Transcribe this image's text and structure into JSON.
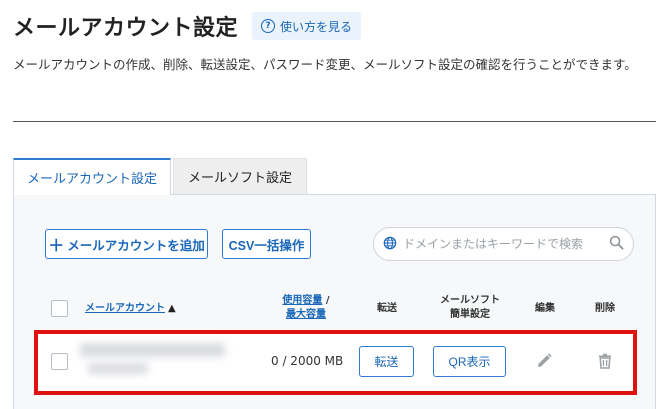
{
  "header": {
    "title": "メールアカウント設定",
    "help_label": "使い方を見る",
    "description": "メールアカウントの作成、削除、転送設定、パスワード変更、メールソフト設定の確認を行うことができます。"
  },
  "tabs": [
    {
      "label": "メールアカウント設定",
      "active": true
    },
    {
      "label": "メールソフト設定",
      "active": false
    }
  ],
  "toolbar": {
    "add_label": "メールアカウントを追加",
    "csv_label": "CSV一括操作",
    "search_placeholder": "ドメインまたはキーワードで検索"
  },
  "table": {
    "col_account": "メールアカウント",
    "sort_arrow": "▲",
    "col_usage_1": "使用容量",
    "col_usage_sep": " /",
    "col_usage_2": "最大容量",
    "col_forward": "転送",
    "col_soft_1": "メールソフト",
    "col_soft_2": "簡単設定",
    "col_edit": "編集",
    "col_delete": "削除",
    "rows": [
      {
        "usage": "0 / 2000 MB",
        "forward_label": "転送",
        "qr_label": "QR表示"
      }
    ]
  },
  "colors": {
    "accent": "#1a66b8",
    "highlight": "#e01111"
  }
}
